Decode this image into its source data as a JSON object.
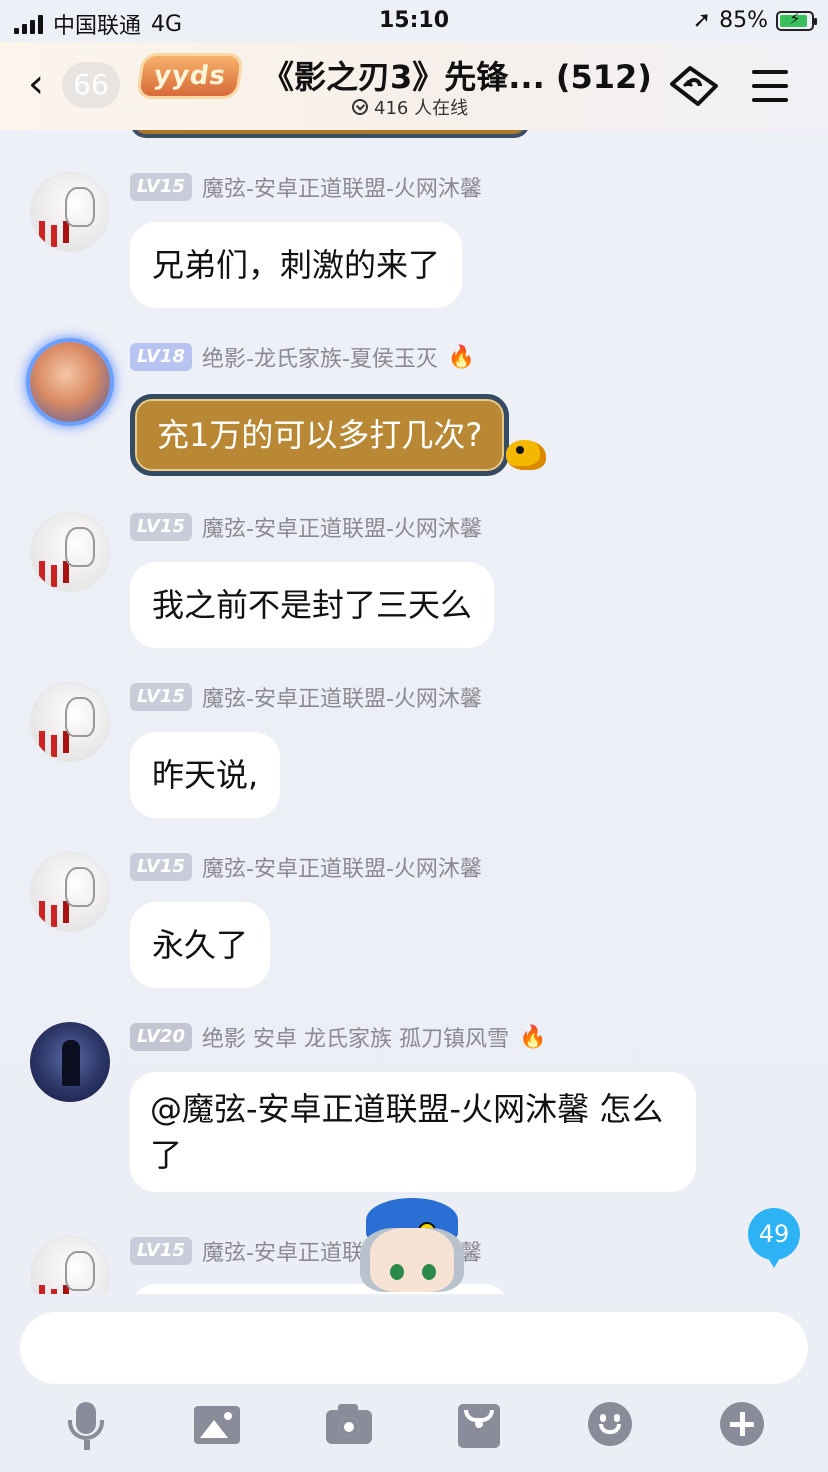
{
  "status_bar": {
    "carrier": "中国联通",
    "network": "4G",
    "time": "15:10",
    "battery": "85%",
    "icons": [
      "signal-icon",
      "location-arrow-icon",
      "battery-charging-icon"
    ]
  },
  "header": {
    "back_icon": "chevron-left-icon",
    "unread_count": "66",
    "badge_text": "yyds",
    "title": "《影之刃3》先锋... (512)",
    "online_text": "416 人在线",
    "ticket_icon": "ticket-swap-icon",
    "menu_icon": "hamburger-menu-icon"
  },
  "messages": [
    {
      "level": "LV15",
      "sender": "魔弦-安卓正道联盟-火网沐馨",
      "text": "兄弟们，刺激的来了",
      "fire": false
    },
    {
      "level": "LV18",
      "sender": "绝影-龙氏家族-夏侯玉灭",
      "text": "充1万的可以多打几次?",
      "fire": true
    },
    {
      "level": "LV15",
      "sender": "魔弦-安卓正道联盟-火网沐馨",
      "text": "我之前不是封了三天么",
      "fire": false
    },
    {
      "level": "LV15",
      "sender": "魔弦-安卓正道联盟-火网沐馨",
      "text": "昨天说,",
      "fire": false
    },
    {
      "level": "LV15",
      "sender": "魔弦-安卓正道联盟-火网沐馨",
      "text": "永久了",
      "fire": false
    },
    {
      "level": "LV20",
      "sender": "绝影 安卓 龙氏家族 孤刀镇风雪",
      "text": "@魔弦-安卓正道联盟-火网沐馨 怎么了",
      "fire": true
    },
    {
      "level": "LV15",
      "sender": "魔弦-安卓正道联盟-火网沐馨",
      "text": "",
      "fire": false
    }
  ],
  "fire_emoji": "🔥",
  "new_message_badge": "49",
  "composer": {
    "placeholder": ""
  },
  "toolbar": [
    "microphone-icon",
    "image-icon",
    "camera-icon",
    "red-packet-icon",
    "emoji-icon",
    "plus-icon"
  ]
}
